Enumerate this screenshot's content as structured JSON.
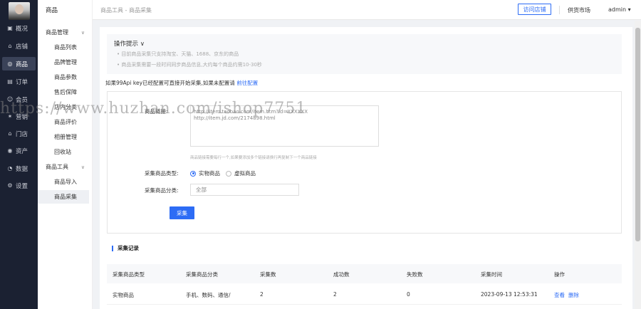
{
  "rail": {
    "items": [
      {
        "icon": "dashboard-icon",
        "glyph": "▣",
        "label": "概况"
      },
      {
        "icon": "store-icon",
        "glyph": "⌂",
        "label": "店铺"
      },
      {
        "icon": "goods-icon",
        "glyph": "◎",
        "label": "商品"
      },
      {
        "icon": "order-icon",
        "glyph": "▤",
        "label": "订单"
      },
      {
        "icon": "member-icon",
        "glyph": "☺",
        "label": "会员"
      },
      {
        "icon": "marketing-icon",
        "glyph": "✶",
        "label": "营销"
      },
      {
        "icon": "outlet-icon",
        "glyph": "⌂",
        "label": "门店"
      },
      {
        "icon": "asset-icon",
        "glyph": "◉",
        "label": "资产"
      },
      {
        "icon": "data-icon",
        "glyph": "◔",
        "label": "数据"
      },
      {
        "icon": "settings-icon",
        "glyph": "⚙",
        "label": "设置"
      }
    ]
  },
  "sidebar": {
    "title": "商品",
    "items": [
      {
        "label": "商品管理",
        "kind": "group"
      },
      {
        "label": "商品列表",
        "kind": "sub"
      },
      {
        "label": "品牌管理",
        "kind": "sub"
      },
      {
        "label": "商品参数",
        "kind": "sub"
      },
      {
        "label": "售后保障",
        "kind": "sub"
      },
      {
        "label": "店内分类",
        "kind": "sub"
      },
      {
        "label": "商品评价",
        "kind": "sub"
      },
      {
        "label": "相册管理",
        "kind": "sub"
      },
      {
        "label": "回收站",
        "kind": "sub"
      },
      {
        "label": "商品工具",
        "kind": "group"
      },
      {
        "label": "商品导入",
        "kind": "sub"
      },
      {
        "label": "商品采集",
        "kind": "sub",
        "active": true
      }
    ]
  },
  "topbar": {
    "breadcrumb": "商品工具 - 商品采集",
    "visit_store": "访问店铺",
    "supplier_market": "供货市场",
    "user": "admin ▾"
  },
  "tips": {
    "title": "操作提示 ∨",
    "lines": [
      "•  目前商品采集只支持淘宝、天猫、1688、京东的商品",
      "•  商品采集需要一段时间同步商品信息,大约每个商品约需10-30秒"
    ]
  },
  "key_note": {
    "text": "如果99Api key已经配置可直接开始采集,如果未配置请 ",
    "link": "前往配置"
  },
  "form": {
    "url_label": "商品链接:",
    "url_value": "http://item.taobao.com/item.htm?id=XXXXXX\nhttp://item.jd.com/2174898.html",
    "url_hint": "商品链接需要每行一个,如果要添加多个链接请换行再复制下一个商品链接",
    "type_label": "采集商品类型:",
    "type_options": [
      "实物商品",
      "虚拟商品"
    ],
    "type_selected": "实物商品",
    "category_label": "采集商品分类:",
    "category_value": "全部",
    "submit": "采集"
  },
  "records": {
    "title": "采集记录",
    "columns": [
      "采集商品类型",
      "采集商品分类",
      "采集数",
      "成功数",
      "失败数",
      "采集时间",
      "操作"
    ],
    "rows": [
      {
        "type": "实物商品",
        "category": "手机、数码、通信/",
        "total": "2",
        "success": "2",
        "failed": "0",
        "time": "2023-09-13 12:53:31",
        "actions": [
          "查看",
          "删除"
        ]
      }
    ]
  },
  "watermark": "https://www.huzhan.com/ishop7751",
  "colors": {
    "accent": "#2d6cf5",
    "rail_bg": "#1b2132"
  }
}
